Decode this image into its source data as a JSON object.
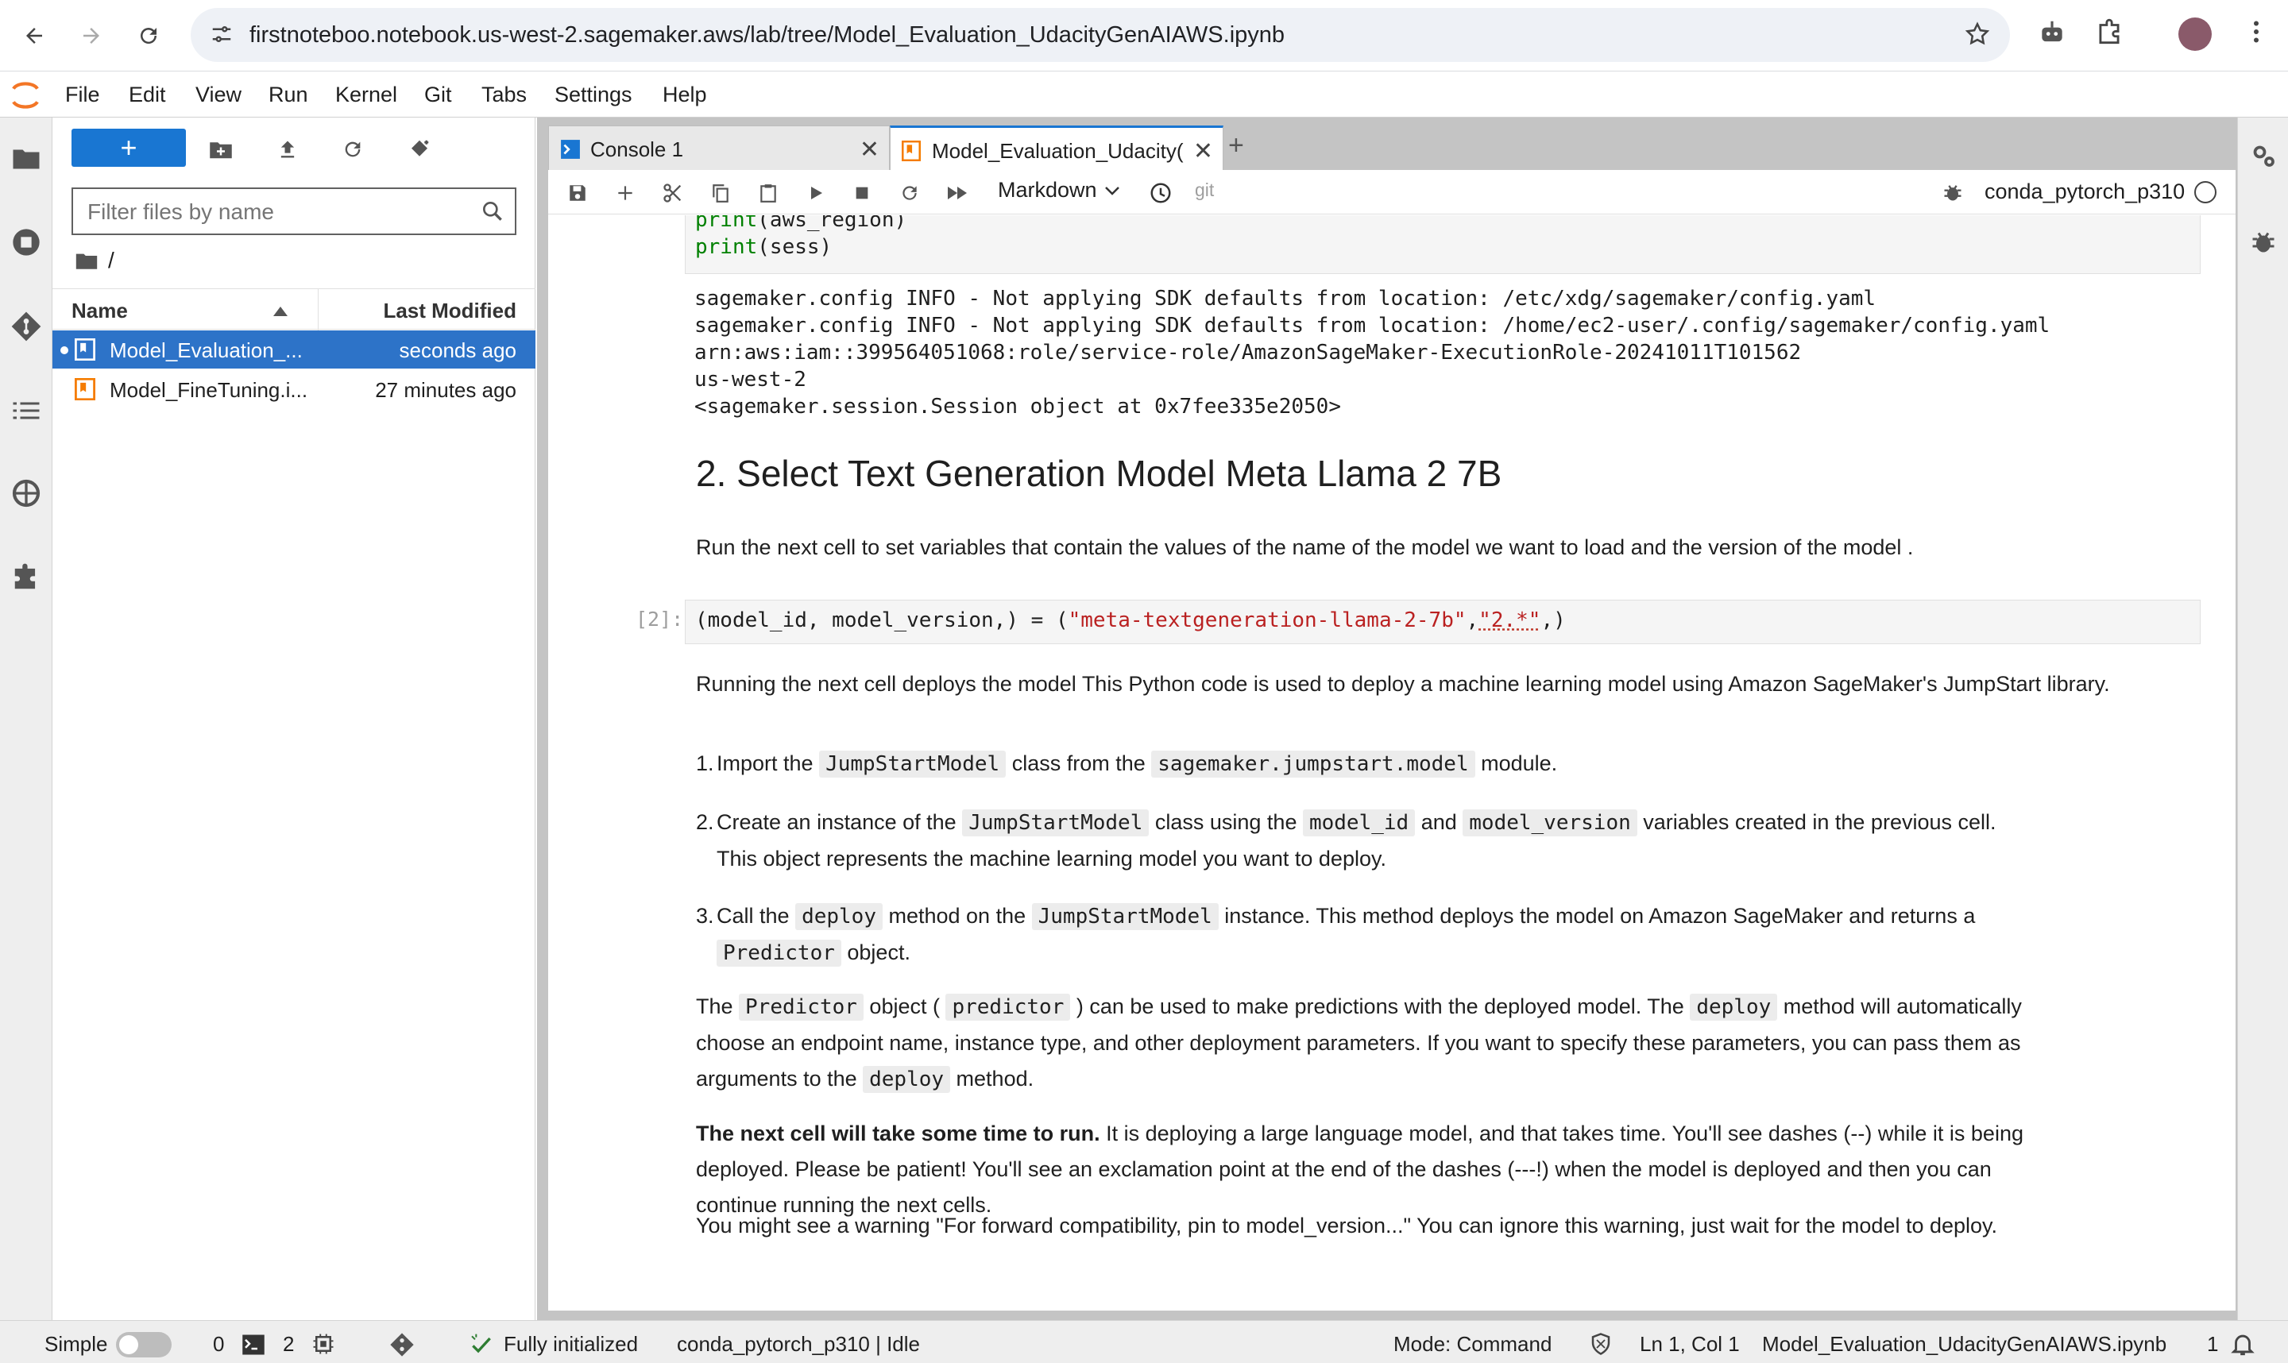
{
  "browser": {
    "url": "firstnoteboo.notebook.us-west-2.sagemaker.aws/lab/tree/Model_Evaluation_UdacityGenAIAWS.ipynb"
  },
  "menu": [
    "File",
    "Edit",
    "View",
    "Run",
    "Kernel",
    "Git",
    "Tabs",
    "Settings",
    "Help"
  ],
  "file_browser": {
    "new_label": "+",
    "filter_placeholder": "Filter files by name",
    "path": "/",
    "col_name": "Name",
    "col_modified": "Last Modified",
    "files": [
      {
        "name": "Model_Evaluation_...",
        "modified": "seconds ago",
        "selected": true
      },
      {
        "name": "Model_FineTuning.i...",
        "modified": "27 minutes ago",
        "selected": false
      }
    ]
  },
  "tabs": [
    {
      "label": "Console 1",
      "active": false
    },
    {
      "label": "Model_Evaluation_Udacity(",
      "active": true
    }
  ],
  "toolbar": {
    "cell_type": "Markdown",
    "git": "git",
    "kernel": "conda_pytorch_p310"
  },
  "notebook": {
    "code_top": [
      "print(aws_region)",
      "print(sess)"
    ],
    "output": [
      "sagemaker.config INFO - Not applying SDK defaults from location: /etc/xdg/sagemaker/config.yaml",
      "sagemaker.config INFO - Not applying SDK defaults from location: /home/ec2-user/.config/sagemaker/config.yaml",
      "arn:aws:iam::399564051068:role/service-role/AmazonSageMaker-ExecutionRole-20241011T101562",
      "us-west-2",
      "<sagemaker.session.Session object at 0x7fee335e2050>"
    ],
    "heading": "2. Select Text Generation Model Meta Llama 2 7B",
    "para1": "Run the next cell to set variables that contain the values of the name of the model we want to load and the version of the model .",
    "prompt2": "[2]:",
    "code2_a": "(model_id, model_version,) = (",
    "code2_str1": "\"meta-textgeneration-llama-2-7b\"",
    "code2_comma": ",",
    "code2_str2": "\"2.*\"",
    "code2_end": ",)",
    "para2": "Running the next cell deploys the model This Python code is used to deploy a machine learning model using Amazon SageMaker's JumpStart library.",
    "list": {
      "i1_a": "Import the ",
      "i1_code1": "JumpStartModel",
      "i1_b": " class from the ",
      "i1_code2": "sagemaker.jumpstart.model",
      "i1_c": " module.",
      "i2_a": "Create an instance of the ",
      "i2_code1": "JumpStartModel",
      "i2_b": " class using the ",
      "i2_code2": "model_id",
      "i2_c": " and ",
      "i2_code3": "model_version",
      "i2_d": " variables created in the previous cell.",
      "i2_line2": "This object represents the machine learning model you want to deploy.",
      "i3_a": "Call the ",
      "i3_code1": "deploy",
      "i3_b": " method on the ",
      "i3_code2": "JumpStartModel",
      "i3_c": " instance. This method deploys the model on Amazon SageMaker and returns a",
      "i3_code3": "Predictor",
      "i3_d": " object."
    },
    "para3": {
      "a": "The ",
      "code1": "Predictor",
      "b": " object ( ",
      "code2": "predictor",
      "c": " ) can be used to make predictions with the deployed model. The ",
      "code3": "deploy",
      "d": " method will automatically",
      "line2": "choose an endpoint name, instance type, and other deployment parameters. If you want to specify these parameters, you can pass them as",
      "e": "arguments to the ",
      "code4": "deploy",
      "f": " method."
    },
    "para4_bold": "The next cell will take some time to run.",
    "para4_rest1": " It is deploying a large language model, and that takes time. You'll see dashes (--) while it is being",
    "para4_line2": "deployed. Please be patient! You'll see an exclamation point at the end of the dashes (---!) when the model is deployed and then you can",
    "para4_line3": "continue running the next cells.",
    "para5": "You might see a warning \"For forward compatibility, pin to model_version...\" You can ignore this warning, just wait for the model to deploy."
  },
  "status": {
    "mode_label": "Simple",
    "terminals": "0",
    "kernels": "2",
    "init": "Fully initialized",
    "kernel_status": "conda_pytorch_p310 | Idle",
    "mode": "Mode: Command",
    "position": "Ln 1, Col 1",
    "file": "Model_Evaluation_UdacityGenAIAWS.ipynb",
    "notifications": "1"
  },
  "colors": {
    "accent": "#1976d2",
    "selected_row": "#2d73c8",
    "notebook_icon": "#f57c00"
  }
}
